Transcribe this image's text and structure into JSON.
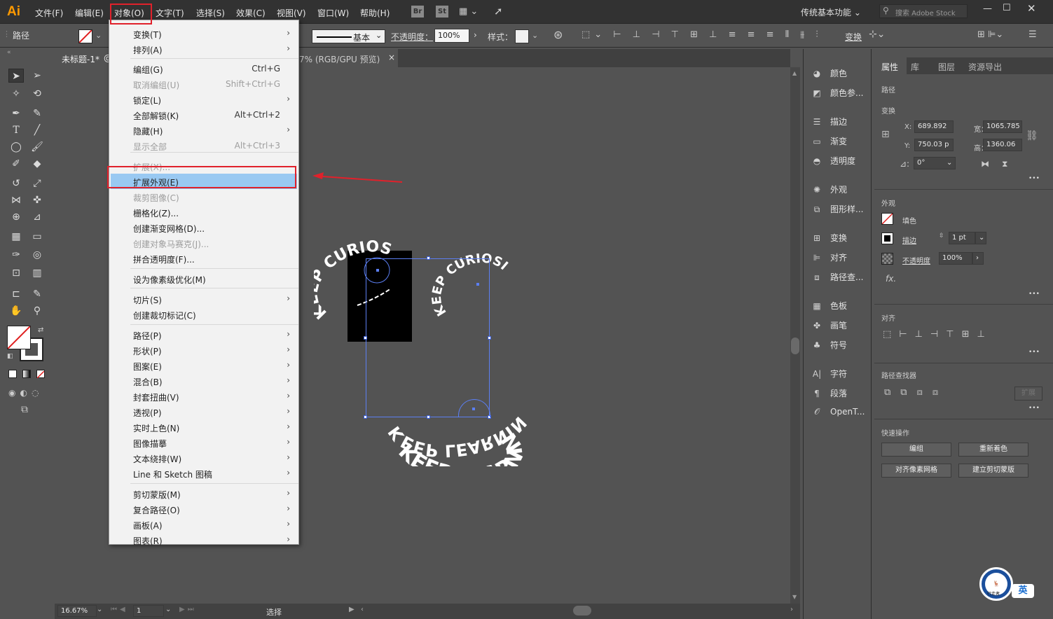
{
  "app": {
    "logo": "Ai",
    "workspace": "传统基本功能",
    "search_placeholder": "搜索 Adobe Stock"
  },
  "menubar": {
    "items": [
      "文件(F)",
      "编辑(E)",
      "对象(O)",
      "文字(T)",
      "选择(S)",
      "效果(C)",
      "视图(V)",
      "窗口(W)",
      "帮助(H)"
    ],
    "br": "Br",
    "st": "St"
  },
  "control": {
    "selection_label": "路径",
    "stroke_style": "基本",
    "opacity_label": "不透明度：",
    "opacity_value": "100%",
    "style_label": "样式：",
    "transform": "变换"
  },
  "document": {
    "tab_title": "未标题-1*",
    "tab_suffix": "7% (RGB/GPU 预览)",
    "close": "×"
  },
  "object_menu": [
    {
      "label": "变换(T)",
      "shortcut": "",
      "arrow": true,
      "disabled": false
    },
    {
      "label": "排列(A)",
      "shortcut": "",
      "arrow": true,
      "disabled": false
    },
    {
      "label": "编组(G)",
      "shortcut": "Ctrl+G",
      "arrow": false,
      "disabled": false
    },
    {
      "label": "取消编组(U)",
      "shortcut": "Shift+Ctrl+G",
      "arrow": false,
      "disabled": true
    },
    {
      "label": "锁定(L)",
      "shortcut": "",
      "arrow": true,
      "disabled": false
    },
    {
      "label": "全部解锁(K)",
      "shortcut": "Alt+Ctrl+2",
      "arrow": false,
      "disabled": false
    },
    {
      "label": "隐藏(H)",
      "shortcut": "",
      "arrow": true,
      "disabled": false
    },
    {
      "label": "显示全部",
      "shortcut": "Alt+Ctrl+3",
      "arrow": false,
      "disabled": true
    },
    {
      "label": "扩展(X)...",
      "shortcut": "",
      "arrow": false,
      "disabled": true
    },
    {
      "label": "扩展外观(E)",
      "shortcut": "",
      "arrow": false,
      "disabled": false
    },
    {
      "label": "裁剪图像(C)",
      "shortcut": "",
      "arrow": false,
      "disabled": true
    },
    {
      "label": "栅格化(Z)...",
      "shortcut": "",
      "arrow": false,
      "disabled": false
    },
    {
      "label": "创建渐变网格(D)...",
      "shortcut": "",
      "arrow": false,
      "disabled": false
    },
    {
      "label": "创建对象马赛克(J)...",
      "shortcut": "",
      "arrow": false,
      "disabled": true
    },
    {
      "label": "拼合透明度(F)...",
      "shortcut": "",
      "arrow": false,
      "disabled": false
    },
    {
      "label": "设为像素级优化(M)",
      "shortcut": "",
      "arrow": false,
      "disabled": false
    },
    {
      "label": "切片(S)",
      "shortcut": "",
      "arrow": true,
      "disabled": false
    },
    {
      "label": "创建裁切标记(C)",
      "shortcut": "",
      "arrow": false,
      "disabled": false
    },
    {
      "label": "路径(P)",
      "shortcut": "",
      "arrow": true,
      "disabled": false
    },
    {
      "label": "形状(P)",
      "shortcut": "",
      "arrow": true,
      "disabled": false
    },
    {
      "label": "图案(E)",
      "shortcut": "",
      "arrow": true,
      "disabled": false
    },
    {
      "label": "混合(B)",
      "shortcut": "",
      "arrow": true,
      "disabled": false
    },
    {
      "label": "封套扭曲(V)",
      "shortcut": "",
      "arrow": true,
      "disabled": false
    },
    {
      "label": "透视(P)",
      "shortcut": "",
      "arrow": true,
      "disabled": false
    },
    {
      "label": "实时上色(N)",
      "shortcut": "",
      "arrow": true,
      "disabled": false
    },
    {
      "label": "图像描摹",
      "shortcut": "",
      "arrow": true,
      "disabled": false
    },
    {
      "label": "文本绕排(W)",
      "shortcut": "",
      "arrow": true,
      "disabled": false
    },
    {
      "label": "Line 和 Sketch 图稿",
      "shortcut": "",
      "arrow": true,
      "disabled": false
    },
    {
      "label": "剪切蒙版(M)",
      "shortcut": "",
      "arrow": true,
      "disabled": false
    },
    {
      "label": "复合路径(O)",
      "shortcut": "",
      "arrow": true,
      "disabled": false
    },
    {
      "label": "画板(A)",
      "shortcut": "",
      "arrow": true,
      "disabled": false
    },
    {
      "label": "图表(R)",
      "shortcut": "",
      "arrow": true,
      "disabled": false
    }
  ],
  "canvas_art": {
    "text1": "KEEP CURIOSITY",
    "text2": "KEEP CURIOSITY KEEP",
    "text3": "KEEP LEARNING",
    "text3_mirror": "KEEP LEARNING"
  },
  "icon_panel": [
    {
      "icon": "color-icon",
      "label": "颜色"
    },
    {
      "icon": "color-guide-icon",
      "label": "颜色参..."
    },
    {
      "icon": "stroke-icon",
      "label": "描边"
    },
    {
      "icon": "gradient-icon",
      "label": "渐变"
    },
    {
      "icon": "transparency-icon",
      "label": "透明度"
    },
    {
      "icon": "appearance-icon",
      "label": "外观"
    },
    {
      "icon": "graphic-styles-icon",
      "label": "图形样..."
    },
    {
      "icon": "transform-icon",
      "label": "变换"
    },
    {
      "icon": "align-icon",
      "label": "对齐"
    },
    {
      "icon": "pathfinder-icon",
      "label": "路径查..."
    },
    {
      "icon": "swatches-icon",
      "label": "色板"
    },
    {
      "icon": "brushes-icon",
      "label": "画笔"
    },
    {
      "icon": "symbols-icon",
      "label": "符号"
    },
    {
      "icon": "character-icon",
      "label": "字符"
    },
    {
      "icon": "paragraph-icon",
      "label": "段落"
    },
    {
      "icon": "opentype-icon",
      "label": "OpenT..."
    }
  ],
  "props_panel": {
    "tabs": [
      "属性",
      "库",
      "图层",
      "资源导出"
    ],
    "path_label": "路径",
    "transform_title": "变换",
    "x_label": "X:",
    "x_value": "689.892",
    "y_label": "Y:",
    "y_value": "750.03 p",
    "w_label": "宽：",
    "w_value": "1065.785",
    "h_label": "高：",
    "h_value": "1360.06",
    "angle_value": "0°",
    "appearance_title": "外观",
    "fill_label": "填色",
    "stroke_label": "描边",
    "stroke_value": "1 pt",
    "opacity_label": "不透明度",
    "opacity_value": "100%",
    "fx": "fx.",
    "align_title": "对齐",
    "pathfinder_title": "路径查找器",
    "expand": "扩展",
    "quick_title": "快速操作",
    "btn_group": "编组",
    "btn_recolor": "重新着色",
    "btn_pixel": "对齐像素网格",
    "btn_clip": "建立剪切蒙版",
    "more": "•••"
  },
  "status": {
    "zoom": "16.67%",
    "artboard": "1",
    "tool": "选择"
  },
  "ime": {
    "label": "英",
    "logo_text": "行走者"
  }
}
